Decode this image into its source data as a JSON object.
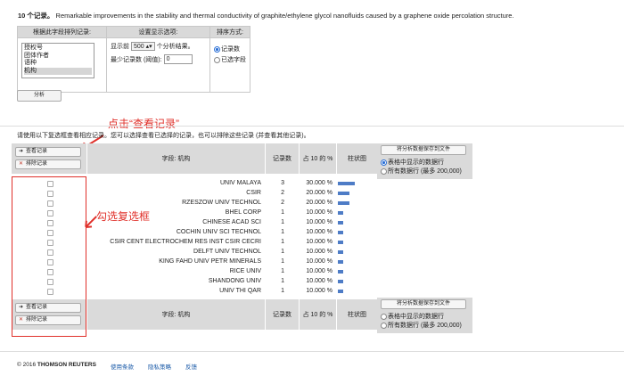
{
  "header": {
    "count_text": "10 个记录。",
    "query_text": "Remarkable improvements in the stability and thermal conductivity of graphite/ethylene glycol nanofluids caused by a graphene oxide percolation structure."
  },
  "options": {
    "col1_header": "根据此字段排列记录:",
    "col2_header": "设置显示选项:",
    "col3_header": "排序方式:",
    "fields": [
      "授权号",
      "团体作者",
      "语种",
      "机构"
    ],
    "selected_field": "机构",
    "show_prefix": "显示前",
    "show_value": "500",
    "show_suffix": "个分析结果。",
    "min_label": "最少记录数 (阈值):",
    "min_value": "0",
    "sort_options": [
      "记录数",
      "已选字段"
    ],
    "analyze_button": "分析"
  },
  "annotations": {
    "view_records": "点击“查看记录”",
    "check_boxes": "勾选复选框"
  },
  "instructions": "请使用以下复选框查看相应记录。您可以选择查看已选择的记录，也可以排除这些记录 (并查看其他记录)。",
  "results": {
    "view_button": "查看记录",
    "exclude_button": "排除记录",
    "col_field": "字段: 机构",
    "col_count": "记录数",
    "col_pct": "占 10 的 %",
    "col_bar": "柱状图",
    "export_button": "将分析数据保存到文件",
    "export_opt1": "表格中显示的数据行",
    "export_opt2": "所有数据行 (最多 200,000)",
    "rows": [
      {
        "name": "UNIV MALAYA",
        "count": "3",
        "pct": "30.000 %",
        "frac": 0.3
      },
      {
        "name": "CSIR",
        "count": "2",
        "pct": "20.000 %",
        "frac": 0.2
      },
      {
        "name": "RZESZOW UNIV TECHNOL",
        "count": "2",
        "pct": "20.000 %",
        "frac": 0.2
      },
      {
        "name": "BHEL CORP",
        "count": "1",
        "pct": "10.000 %",
        "frac": 0.1
      },
      {
        "name": "CHINESE ACAD SCI",
        "count": "1",
        "pct": "10.000 %",
        "frac": 0.1
      },
      {
        "name": "COCHIN UNIV SCI TECHNOL",
        "count": "1",
        "pct": "10.000 %",
        "frac": 0.1
      },
      {
        "name": "CSIR CENT ELECTROCHEM RES INST CSIR CECRI",
        "count": "1",
        "pct": "10.000 %",
        "frac": 0.1
      },
      {
        "name": "DELFT UNIV TECHNOL",
        "count": "1",
        "pct": "10.000 %",
        "frac": 0.1
      },
      {
        "name": "KING FAHD UNIV PETR MINERALS",
        "count": "1",
        "pct": "10.000 %",
        "frac": 0.1
      },
      {
        "name": "RICE UNIV",
        "count": "1",
        "pct": "10.000 %",
        "frac": 0.1
      },
      {
        "name": "SHANDONG UNIV",
        "count": "1",
        "pct": "10.000 %",
        "frac": 0.1
      },
      {
        "name": "UNIV THI QAR",
        "count": "1",
        "pct": "10.000 %",
        "frac": 0.1
      }
    ]
  },
  "footer": {
    "copyright": "© 2016",
    "brand": "THOMSON REUTERS",
    "links": [
      "使用条款",
      "隐私策略",
      "反馈"
    ]
  },
  "colors": {
    "annotation": "#e0302a",
    "bar": "#4e7cc6",
    "link": "#1a5aa8"
  }
}
